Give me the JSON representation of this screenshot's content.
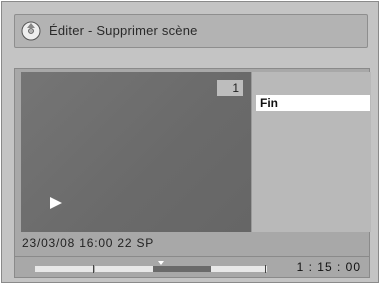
{
  "title": "Éditer - Supprimer scène",
  "icons": {
    "title": "disc-edit-icon",
    "play": "play-icon"
  },
  "preview": {
    "scene_number": "1"
  },
  "menu": {
    "items": [
      {
        "label": "Fin",
        "selected": true
      }
    ]
  },
  "info": {
    "text": "23/03/08  16:00  22  SP"
  },
  "timeline": {
    "time": "1 : 15 : 00"
  }
}
